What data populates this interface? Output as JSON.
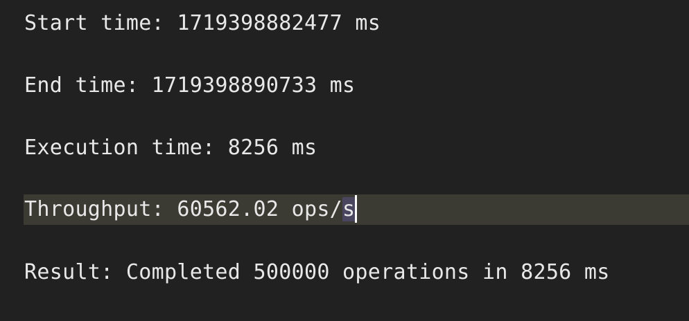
{
  "lines": [
    {
      "text": "Start time: 1719398882477 ms"
    },
    {
      "text": "End time: 1719398890733 ms"
    },
    {
      "text": "Execution time: 8256 ms"
    },
    {
      "text_before_cursor": "Throughput: 60562.02 ops/",
      "selected_char": "s"
    },
    {
      "text": "Result: Completed 500000 operations in 8256 ms"
    }
  ],
  "colors": {
    "background": "#212121",
    "text": "#e8e8e8",
    "current_line_highlight": "#3b3b33",
    "selection": "#4a4660",
    "caret": "#ffffff"
  }
}
